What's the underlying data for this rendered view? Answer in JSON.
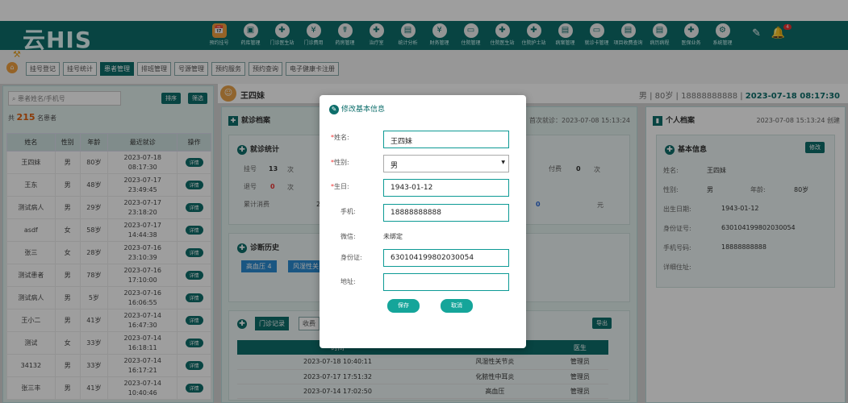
{
  "app": {
    "logo": "云HIS"
  },
  "nav": [
    {
      "label": "预约挂号",
      "icon": "calendar-icon"
    },
    {
      "label": "药库管理",
      "icon": "warehouse-icon"
    },
    {
      "label": "门诊医生站",
      "icon": "doctor-icon"
    },
    {
      "label": "门诊费用",
      "icon": "money-icon"
    },
    {
      "label": "药房管理",
      "icon": "pharmacy-icon"
    },
    {
      "label": "治疗室",
      "icon": "treatment-icon"
    },
    {
      "label": "统计分析",
      "icon": "chart-icon"
    },
    {
      "label": "财务管理",
      "icon": "finance-icon"
    },
    {
      "label": "住院管理",
      "icon": "bed-icon"
    },
    {
      "label": "住院医生站",
      "icon": "inpatient-doctor-icon"
    },
    {
      "label": "住院护士站",
      "icon": "nurse-icon"
    },
    {
      "label": "病案管理",
      "icon": "record-icon"
    },
    {
      "label": "就诊卡管理",
      "icon": "card-icon"
    },
    {
      "label": "项目收费查询",
      "icon": "query-icon"
    },
    {
      "label": "病历病程",
      "icon": "medical-record-icon"
    },
    {
      "label": "医保业务",
      "icon": "insurance-icon"
    },
    {
      "label": "系统管理",
      "icon": "settings-icon"
    }
  ],
  "notifications": {
    "count": "4"
  },
  "tabs": [
    "挂号登记",
    "挂号统计",
    "患者管理",
    "排班管理",
    "号源管理",
    "预约服务",
    "预约查询",
    "电子健康卡注册"
  ],
  "active_tab": "患者管理",
  "left": {
    "search_placeholder": "患者姓名/手机号",
    "sort_label": "排序",
    "filter_label": "筛选",
    "count_prefix": "共",
    "count": "215",
    "count_suffix": "名患者",
    "columns": [
      "姓名",
      "性别",
      "年龄",
      "最近就诊",
      "操作"
    ],
    "detail_label": "详情",
    "rows": [
      {
        "name": "王四妹",
        "sex": "男",
        "age": "80岁",
        "date": "2023-07-18",
        "time": "08:17:30"
      },
      {
        "name": "王东",
        "sex": "男",
        "age": "48岁",
        "date": "2023-07-17",
        "time": "23:49:45"
      },
      {
        "name": "测试病人",
        "sex": "男",
        "age": "29岁",
        "date": "2023-07-17",
        "time": "23:18:20"
      },
      {
        "name": "asdf",
        "sex": "女",
        "age": "58岁",
        "date": "2023-07-17",
        "time": "14:44:38"
      },
      {
        "name": "张三",
        "sex": "女",
        "age": "28岁",
        "date": "2023-07-16",
        "time": "23:10:39"
      },
      {
        "name": "测试患者",
        "sex": "男",
        "age": "78岁",
        "date": "2023-07-16",
        "time": "17:10:00"
      },
      {
        "name": "测试病人",
        "sex": "男",
        "age": "5岁",
        "date": "2023-07-16",
        "time": "16:06:55"
      },
      {
        "name": "王小二",
        "sex": "男",
        "age": "41岁",
        "date": "2023-07-14",
        "time": "16:47:30"
      },
      {
        "name": "测试",
        "sex": "女",
        "age": "33岁",
        "date": "2023-07-14",
        "time": "16:18:11"
      },
      {
        "name": "34132",
        "sex": "男",
        "age": "33岁",
        "date": "2023-07-14",
        "time": "16:17:21"
      },
      {
        "name": "张三丰",
        "sex": "男",
        "age": "41岁",
        "date": "2023-07-14",
        "time": "10:40:46"
      }
    ]
  },
  "patient": {
    "name": "王四妹",
    "info": "男 | 80岁 | 18888888888 |",
    "datetime": "2023-07-18 08:17:30"
  },
  "archive": {
    "title": "就诊档案",
    "last_visit": "首次就诊：2023-07-08 15:13:24",
    "stats_title": "就诊统计",
    "reg_label": "挂号",
    "reg_value": "13",
    "unit": "次",
    "refund_label": "退号",
    "refund_value": "0",
    "total_label": "累计消费",
    "total_value": "2",
    "pay_label": "付费",
    "pay_value": "0",
    "fee_value": "0",
    "fee_unit": "元",
    "history_title": "诊断历史",
    "chips": [
      "高血压  4",
      "风湿性关"
    ],
    "record_tab": "门诊记录",
    "fee_tab": "收费",
    "export_label": "导出",
    "columns": [
      "时间",
      "",
      "",
      "医生"
    ],
    "records": [
      {
        "time": "2023-07-18 10:40:11",
        "diag": "风湿性关节炎",
        "doctor": "管理员"
      },
      {
        "time": "2023-07-17 17:51:32",
        "diag": "化脓性中耳炎",
        "doctor": "管理员"
      },
      {
        "time": "2023-07-14 17:02:50",
        "diag": "高血压",
        "doctor": "管理员"
      }
    ]
  },
  "personal": {
    "title": "个人档案",
    "created": "2023-07-08 15:13:24 创建",
    "basic_title": "基本信息",
    "edit_label": "修改",
    "fields": {
      "name_label": "姓名:",
      "name": "王四妹",
      "sex_label": "性别:",
      "sex": "男",
      "age_label": "年龄:",
      "age": "80岁",
      "birth_label": "出生日期:",
      "birth": "1943-01-12",
      "id_label": "身份证号:",
      "id": "630104199802030054",
      "phone_label": "手机号码:",
      "phone": "18888888888",
      "addr_label": "详细住址:"
    }
  },
  "modal": {
    "title": "修改基本信息",
    "name_label": "姓名:",
    "name": "王四妹",
    "sex_label": "性别:",
    "sex": "男",
    "birth_label": "生日:",
    "birth": "1943-01-12",
    "phone_label": "手机:",
    "phone": "18888888888",
    "wechat_label": "微信:",
    "wechat": "未绑定",
    "id_label": "身份证:",
    "id": "630104199802030054",
    "addr_label": "地址:",
    "addr": "",
    "save": "保存",
    "cancel": "取消"
  }
}
